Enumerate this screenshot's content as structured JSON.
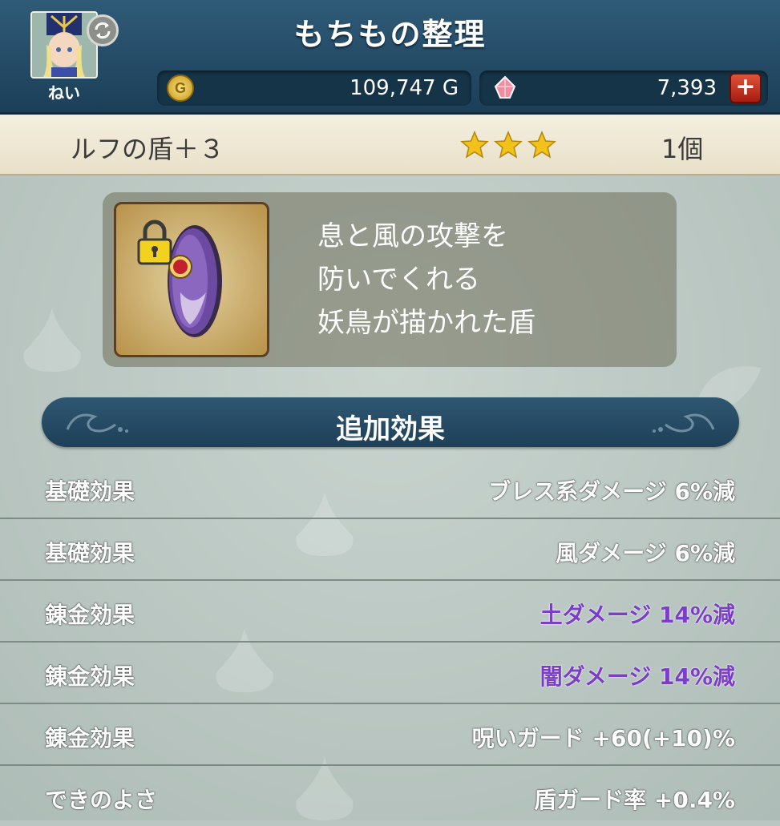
{
  "header": {
    "title": "もちもの整理",
    "player_name": "ねい",
    "gold": "109,747 G",
    "gems": "7,393",
    "plus_label": "+"
  },
  "item": {
    "name": "ルフの盾＋３",
    "stars": 3,
    "count": "1個"
  },
  "description": {
    "lines": [
      "息と風の攻撃を",
      "防いでくれる",
      "妖鳥が描かれた盾"
    ]
  },
  "effects": {
    "title": "追加効果",
    "rows": [
      {
        "label": "基礎効果",
        "value": "ブレス系ダメージ  6%減",
        "highlight": false
      },
      {
        "label": "基礎効果",
        "value": "風ダメージ  6%減",
        "highlight": false
      },
      {
        "label": "錬金効果",
        "value": "土ダメージ  14%減",
        "highlight": true
      },
      {
        "label": "錬金効果",
        "value": "闇ダメージ  14%減",
        "highlight": true
      },
      {
        "label": "錬金効果",
        "value": "呪いガード  +60(+10)%",
        "highlight": false
      },
      {
        "label": "できのよさ",
        "value": "盾ガード率  +0.4%",
        "highlight": false
      }
    ]
  },
  "colors": {
    "header": "#1c3f58",
    "alchemy_text": "#7a3fc6",
    "star": "#f2c21b"
  },
  "icons": [
    "avatar",
    "sync-icon",
    "gold-coin-icon",
    "gem-icon",
    "plus-icon",
    "star-icon",
    "lock-icon",
    "shield-icon"
  ]
}
